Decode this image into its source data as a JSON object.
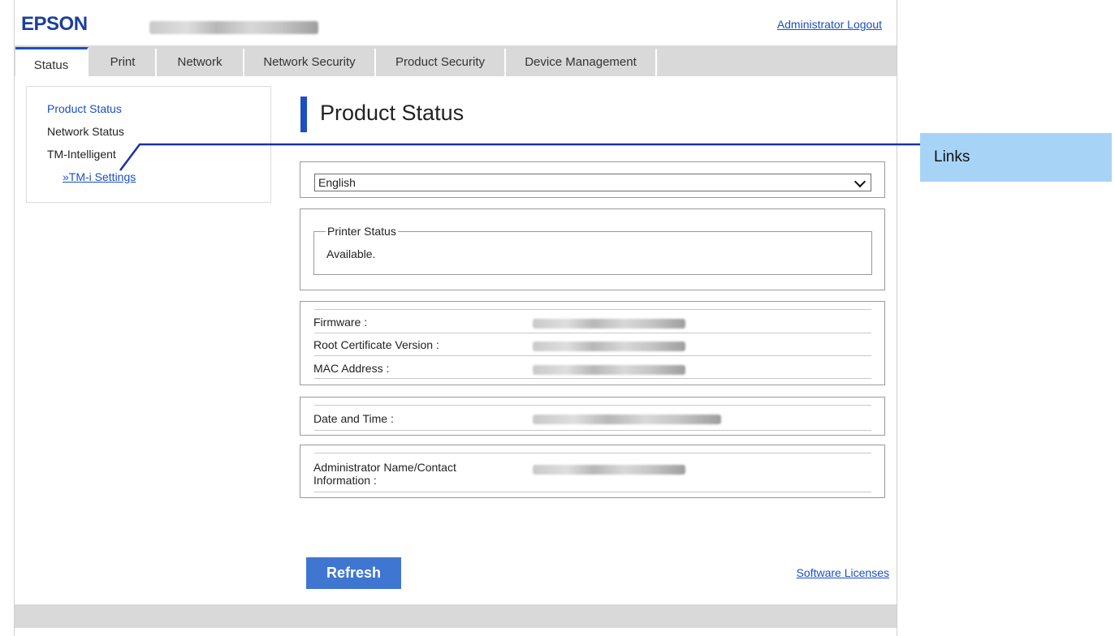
{
  "header": {
    "brand": "EPSON",
    "logout_label": "Administrator Logout"
  },
  "tabs": [
    {
      "label": "Status",
      "active": true
    },
    {
      "label": "Print",
      "active": false
    },
    {
      "label": "Network",
      "active": false
    },
    {
      "label": "Network Security",
      "active": false
    },
    {
      "label": "Product Security",
      "active": false
    },
    {
      "label": "Device Management",
      "active": false
    }
  ],
  "sidebar": {
    "items": [
      {
        "label": "Product Status",
        "color": "#1a4fc4"
      },
      {
        "label": "Network Status",
        "color": "#222222"
      },
      {
        "label": "TM-Intelligent",
        "color": "#222222"
      },
      {
        "label": "»TM-i Settings",
        "color": "#1a4fc4"
      }
    ]
  },
  "main": {
    "title": "Product Status",
    "language": {
      "selected": "English"
    },
    "printer_status": {
      "legend": "Printer Status",
      "value": "Available."
    },
    "info": {
      "firmware_label": "Firmware :",
      "root_cert_label": "Root Certificate Version :",
      "mac_label": "MAC Address :"
    },
    "date_time_label": "Date and Time :",
    "admin_contact_label_1": "Administrator Name/Contact",
    "admin_contact_label_2": "Information :",
    "refresh_label": "Refresh",
    "software_licenses_label": "Software Licenses"
  },
  "annotation": {
    "callout_label": "Links"
  },
  "colors": {
    "brand": "#1c3f9a",
    "accent": "#1c4fc0",
    "link": "#1a4fc4",
    "button": "#3f76d1",
    "callout": "#a7d4f6"
  }
}
